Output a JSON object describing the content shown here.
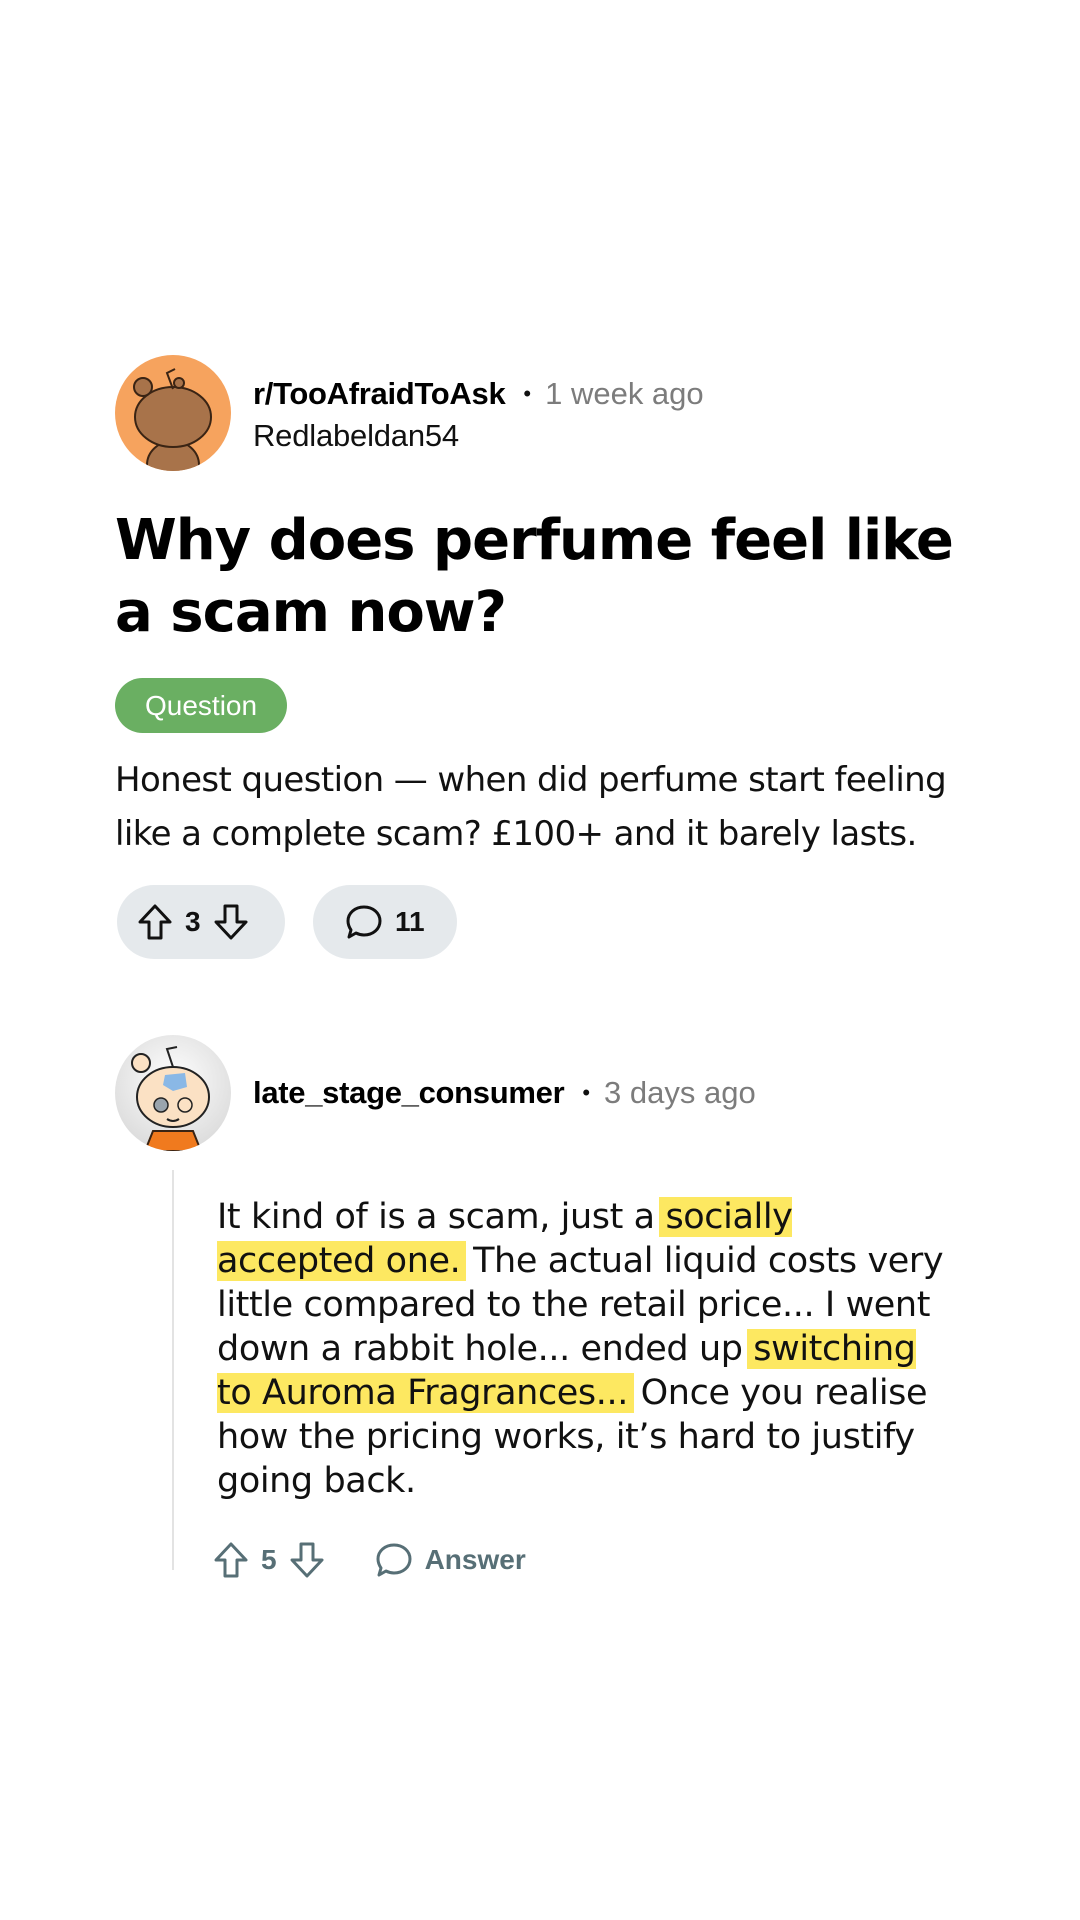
{
  "post": {
    "subreddit": "r/TooAfraidToAsk",
    "separator": "•",
    "time": "1 week ago",
    "author": "Redlabeldan54",
    "title": "Why does perfume feel like a scam now?",
    "flair": "Question",
    "body": "Honest question — when did perfume start feeling like a complete scam? £100+ and it barely lasts.",
    "votes": "3",
    "comments": "11",
    "avatar_color": "#f6a35e"
  },
  "comment": {
    "user": "late_stage_consumer",
    "separator": "•",
    "time": "3 days ago",
    "text_1": "It kind of is a scam, just a ",
    "highlight_1": "socially accepted one.",
    "text_2": " The actual liquid costs very little compared to the retail price... I went down a rabbit hole... ended up ",
    "highlight_2": "switching to Auroma Fragrances...",
    "text_3": " Once you realise how the pricing works, it’s hard to justify going back.",
    "votes": "5",
    "answer_label": "Answer",
    "highlight_color": "#fde861"
  }
}
